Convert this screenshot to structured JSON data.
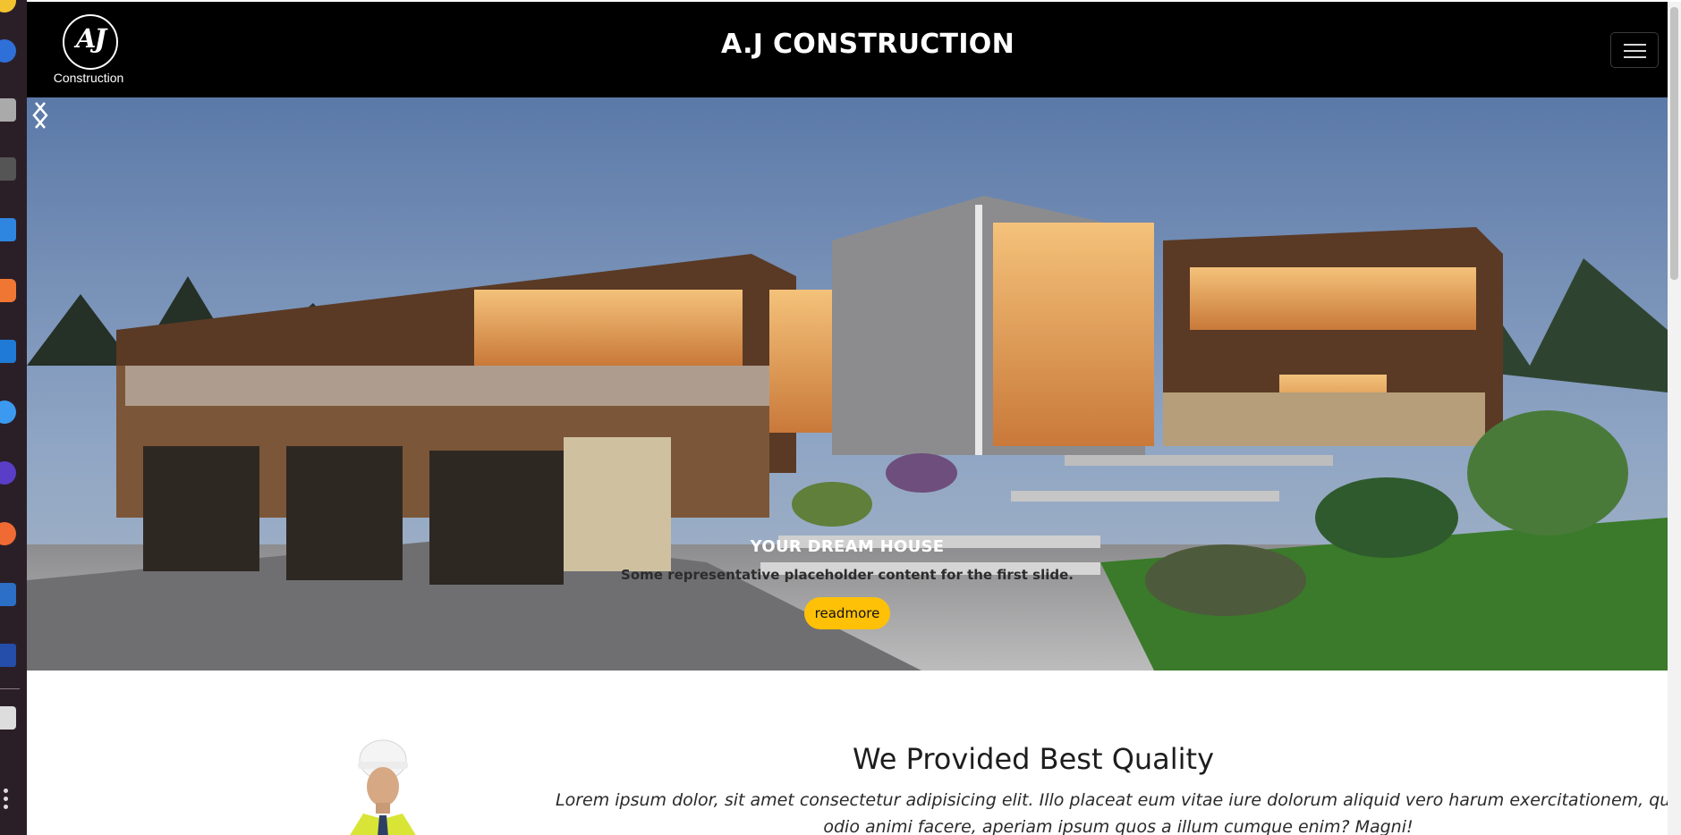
{
  "navbar": {
    "logo_mark": "AJ",
    "logo_sub": "Construction",
    "brand": "A.J CONSTRUCTION",
    "toggler_icon": "hamburger-icon"
  },
  "hero": {
    "caption_title": "YOUR DREAM HOUSE",
    "caption_text": "Some representative placeholder content for the first slide.",
    "button_label": "readmore",
    "prev_icon": "chevron-left-icon",
    "next_icon": "chevron-right-icon"
  },
  "quality": {
    "title": "We Provided Best Quality",
    "body": "Lorem ipsum dolor, sit amet consectetur adipisicing elit. Illo placeat eum vitae iure dolorum aliquid vero harum exercitationem, quo odio animi facere, aperiam ipsum quos a illum cumque enim? Magni!"
  },
  "colors": {
    "navbar_bg": "#000000",
    "button_bg": "#ffc107",
    "dock_bg": "#2b1f27"
  }
}
